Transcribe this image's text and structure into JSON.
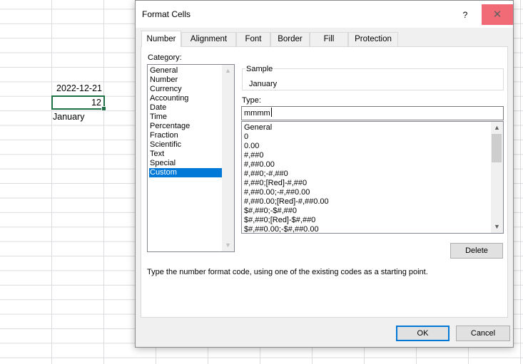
{
  "sheet": {
    "cells": {
      "date": "2022-12-21",
      "number": "12",
      "month": "January"
    }
  },
  "dialog": {
    "title": "Format Cells",
    "help_label": "?",
    "close_label": "✕",
    "tabs": [
      "Number",
      "Alignment",
      "Font",
      "Border",
      "Fill",
      "Protection"
    ],
    "active_tab": "Number",
    "category": {
      "label": "Category:",
      "items": [
        "General",
        "Number",
        "Currency",
        "Accounting",
        "Date",
        "Time",
        "Percentage",
        "Fraction",
        "Scientific",
        "Text",
        "Special",
        "Custom"
      ],
      "selected": "Custom"
    },
    "sample": {
      "label": "Sample",
      "value": "January"
    },
    "type": {
      "label": "Type:",
      "value": "mmmm"
    },
    "format_codes": [
      "General",
      "0",
      "0.00",
      "#,##0",
      "#,##0.00",
      "#,##0;-#,##0",
      "#,##0;[Red]-#,##0",
      "#,##0.00;-#,##0.00",
      "#,##0.00;[Red]-#,##0.00",
      "$#,##0;-$#,##0",
      "$#,##0;[Red]-$#,##0",
      "$#,##0.00;-$#,##0.00"
    ],
    "delete_label": "Delete",
    "hint": "Type the number format code, using one of the existing codes as a starting point.",
    "ok_label": "OK",
    "cancel_label": "Cancel"
  },
  "colors": {
    "selection": "#0078d7",
    "cell_border": "#1f7145",
    "close_hover": "#e81123"
  },
  "icons": {
    "scroll_up": "chevron-up-icon",
    "scroll_down": "chevron-down-icon"
  }
}
